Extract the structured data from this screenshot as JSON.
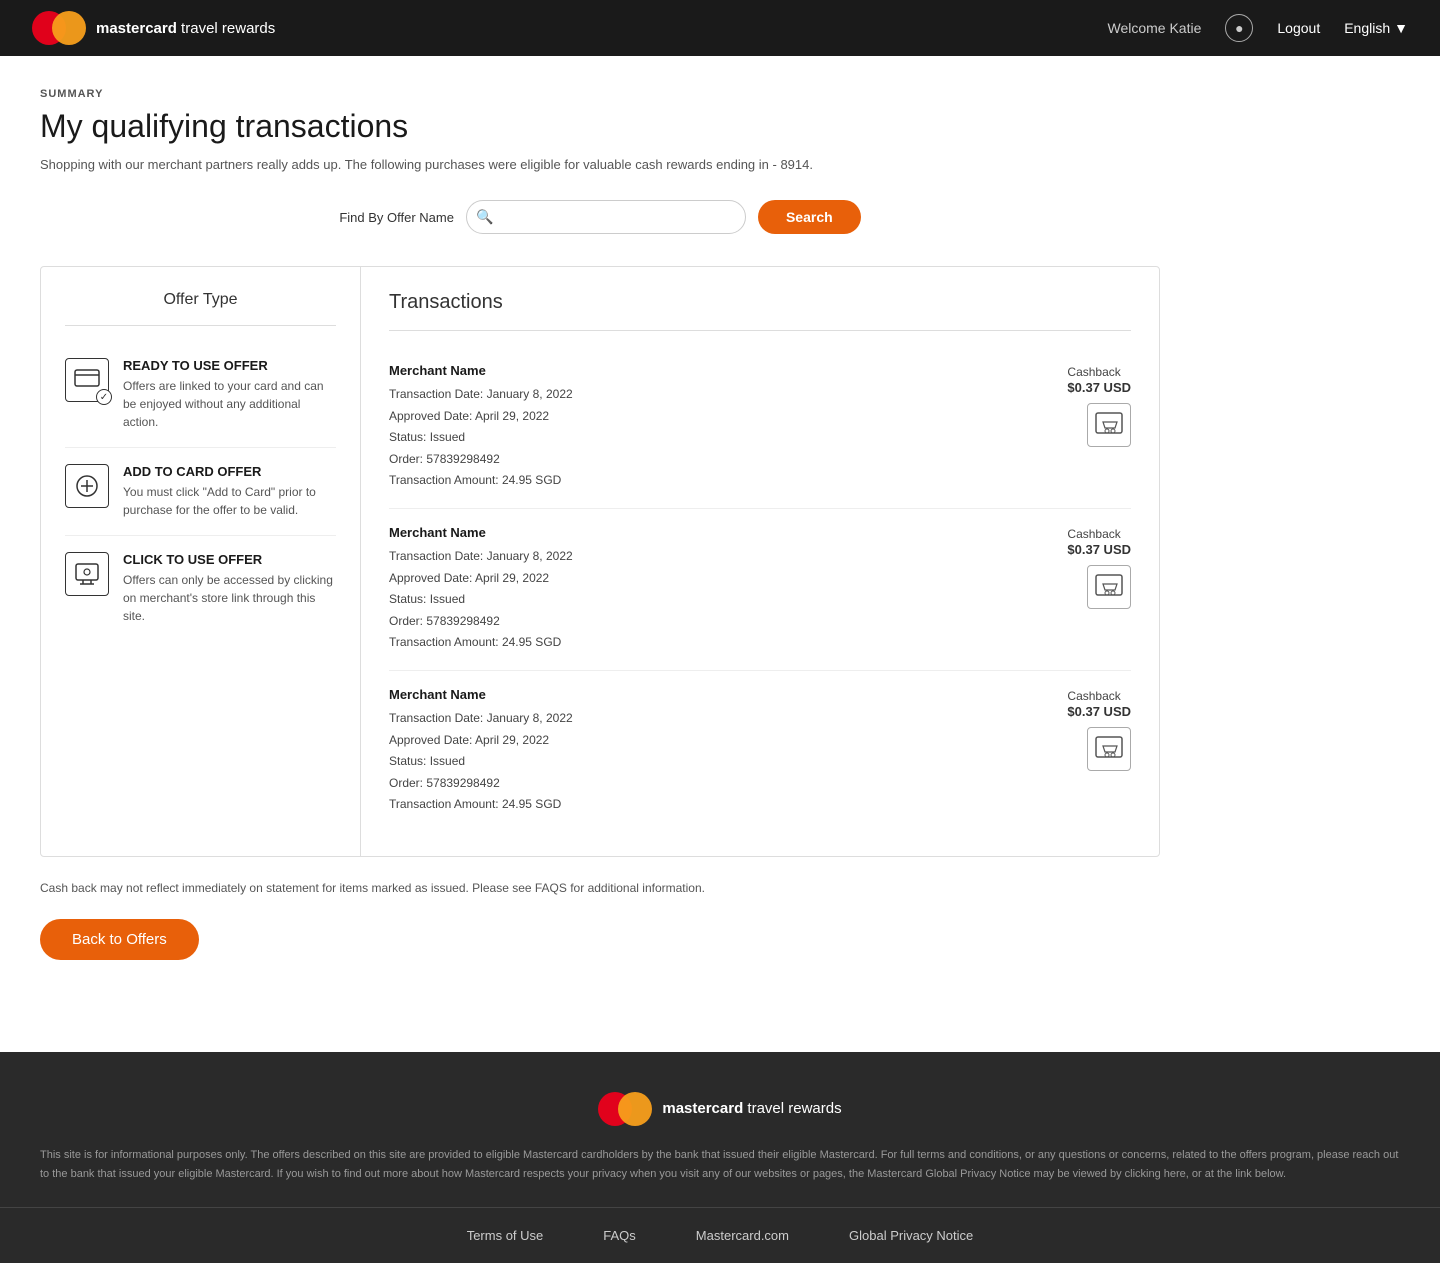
{
  "header": {
    "brand_bold": "mastercard",
    "brand_light": " travel rewards",
    "welcome": "Welcome Katie",
    "logout": "Logout",
    "language": "English"
  },
  "page": {
    "summary_label": "SUMMARY",
    "title": "My qualifying transactions",
    "description": "Shopping with our merchant partners really adds up. The following purchases were eligible for valuable cash rewards ending in - 8914."
  },
  "search": {
    "label": "Find By Offer Name",
    "placeholder": "",
    "button": "Search"
  },
  "offer_types": {
    "panel_title": "Offer Type",
    "items": [
      {
        "name": "READY TO USE OFFER",
        "desc": "Offers are linked to your card and can be enjoyed without any additional action."
      },
      {
        "name": "ADD TO CARD OFFER",
        "desc": "You must click \"Add to Card\" prior to purchase for the offer to be valid."
      },
      {
        "name": "CLICK TO USE OFFER",
        "desc": "Offers can only be accessed by clicking on merchant's store link through this site."
      }
    ]
  },
  "transactions": {
    "title": "Transactions",
    "items": [
      {
        "merchant": "Merchant Name",
        "transaction_date": "Transaction Date: January 8, 2022",
        "approved_date": "Approved Date: April 29, 2022",
        "status": "Status: Issued",
        "order": "Order: 57839298492",
        "amount": "Transaction Amount: 24.95 SGD",
        "cashback_label": "Cashback",
        "cashback_amount": "$0.37 USD"
      },
      {
        "merchant": "Merchant Name",
        "transaction_date": "Transaction Date: January 8, 2022",
        "approved_date": "Approved Date: April 29, 2022",
        "status": "Status: Issued",
        "order": "Order: 57839298492",
        "amount": "Transaction Amount: 24.95 SGD",
        "cashback_label": "Cashback",
        "cashback_amount": "$0.37 USD"
      },
      {
        "merchant": "Merchant Name",
        "transaction_date": "Transaction Date: January 8, 2022",
        "approved_date": "Approved Date: April 29, 2022",
        "status": "Status: Issued",
        "order": "Order: 57839298492",
        "amount": "Transaction Amount: 24.95 SGD",
        "cashback_label": "Cashback",
        "cashback_amount": "$0.37 USD"
      }
    ],
    "note": "Cash back may not reflect immediately on statement for items marked as issued. Please see FAQS for additional information."
  },
  "back_button": "Back to Offers",
  "footer": {
    "brand_bold": "mastercard",
    "brand_light": " travel rewards",
    "disclaimer": "This site is for informational purposes only. The offers described on this site are provided to eligible Mastercard cardholders by the bank that issued their eligible Mastercard. For full terms and conditions, or any questions or concerns, related to the offers program, please reach out to the bank that issued your eligible Mastercard. If you wish to find out more about how Mastercard respects your privacy when you visit any of our websites or pages, the Mastercard Global Privacy Notice may be viewed by clicking here, or at the link below.",
    "links": [
      "Terms of Use",
      "FAQs",
      "Mastercard.com",
      "Global Privacy Notice"
    ]
  }
}
